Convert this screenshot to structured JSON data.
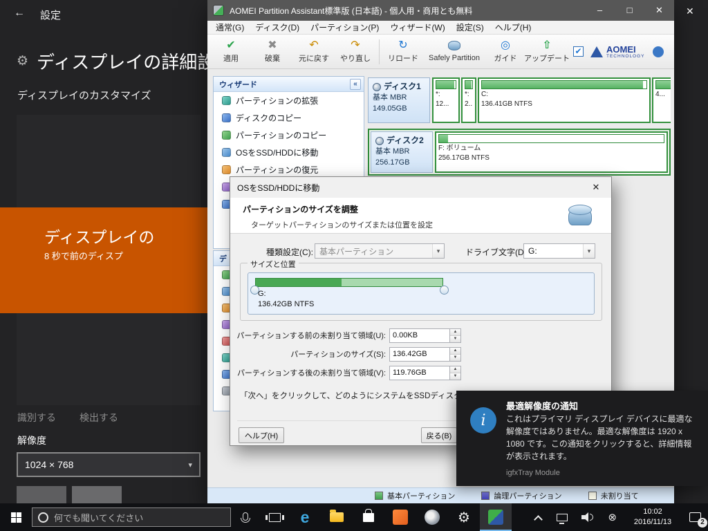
{
  "settings": {
    "app_title": "設定",
    "page_title": "ディスプレイの詳細設定",
    "section_title": "ディスプレイのカスタマイズ",
    "banner": {
      "line1": "ディスプレイの",
      "line2": "8 秒で前のディスプ"
    },
    "identify_link": "識別する",
    "detect_link": "検出する",
    "resolution_label": "解像度",
    "resolution_value": "1024 × 768"
  },
  "aomei": {
    "window_title": "AOMEI Partition Assistant標準版 (日本語) - 個人用・商用とも無料",
    "menu": [
      "通常(G)",
      "ディスク(D)",
      "パーティション(P)",
      "ウィザード(W)",
      "設定(S)",
      "ヘルプ(H)"
    ],
    "toolbar": {
      "apply": "適用",
      "discard": "破棄",
      "undo": "元に戻す",
      "redo": "やり直し",
      "reload": "リロード",
      "safely": "Safely Partition",
      "guide": "ガイド",
      "update": "アップデート",
      "brand_name": "AOMEI",
      "brand_sub": "TECHNOLOGY"
    },
    "wizard": {
      "header": "ウィザード",
      "items": [
        "パーティションの拡張",
        "ディスクのコピー",
        "パーティションのコピー",
        "OSをSSD/HDDに移動",
        "パーティションの復元"
      ]
    },
    "partial_panel_header": "デ",
    "disk1": {
      "name": "ディスク1",
      "type": "基本 MBR",
      "size": "149.05GB",
      "p1_label": "*:",
      "p1_info": "12...",
      "p2_label": "*:",
      "p2_info": "2...",
      "p3_label": "C:",
      "p3_info": "136.41GB NTFS",
      "p4_info": "4..."
    },
    "disk2": {
      "name": "ディスク2",
      "type": "基本 MBR",
      "size": "256.17GB",
      "p1_label": "F: ボリューム",
      "p1_info": "256.17GB NTFS"
    },
    "legend": {
      "primary": "基本パーティション",
      "logical": "論理パーティション",
      "unallocated": "未割り当て"
    }
  },
  "dialog": {
    "title": "OSをSSD/HDDに移動",
    "heading": "パーティションのサイズを調整",
    "subheading": "ターゲットパーティションのサイズまたは位置を設定",
    "type_label": "種類設定(C):",
    "type_value": "基本パーティション",
    "drive_label": "ドライブ文字(D):",
    "drive_value": "G:",
    "group_title": "サイズと位置",
    "bar_label": "G:",
    "bar_info": "136.42GB NTFS",
    "before_label": "パーティションする前の未割り当て領域(U):",
    "before_value": "0.00KB",
    "size_label": "パーティションのサイズ(S):",
    "size_value": "136.42GB",
    "after_label": "パーティションする後の未割り当て領域(V):",
    "after_value": "119.76GB",
    "note": "「次へ」をクリックして、どのようにシステムをSSDディスクから起動すること",
    "help_button": "ヘルプ(H)",
    "back_button": "戻る(B)"
  },
  "notification": {
    "title": "最適解像度の通知",
    "body": "これはプライマリ ディスプレイ デバイスに最適な解像度ではありません。最適な解像度は 1920 x 1080 です。この通知をクリックすると、詳細情報が表示されます。",
    "source": "igfxTray Module"
  },
  "taskbar": {
    "search_placeholder": "何でも聞いてください",
    "time": "10:02",
    "date": "2016/11/13",
    "badge_count": "2"
  }
}
